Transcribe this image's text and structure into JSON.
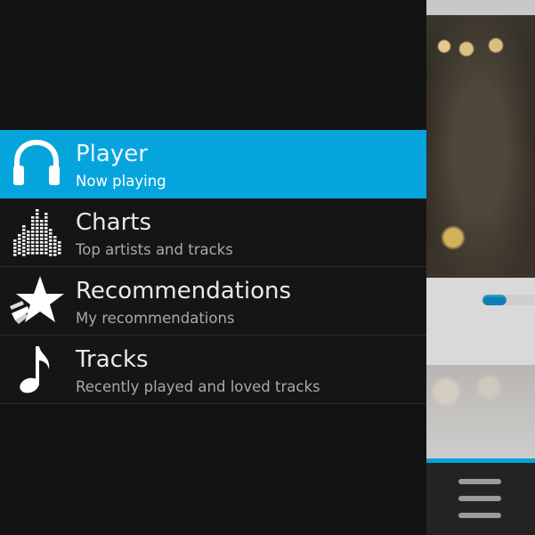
{
  "drawer": {
    "items": [
      {
        "title": "Player",
        "subtitle": "Now playing",
        "icon": "headphones-icon",
        "active": true
      },
      {
        "title": "Charts",
        "subtitle": "Top artists and tracks",
        "icon": "equalizer-bars-icon",
        "active": false
      },
      {
        "title": "Recommendations",
        "subtitle": "My recommendations",
        "icon": "shooting-star-icon",
        "active": false
      },
      {
        "title": "Tracks",
        "subtitle": "Recently played and loved tracks",
        "icon": "music-note-icon",
        "active": false
      }
    ]
  },
  "player_panel": {
    "accent_color": "#07a3d8",
    "slider_level": 0.45,
    "menu_icon": "hamburger-menu-icon"
  },
  "colors": {
    "active_item": "#06a4dd",
    "background": "#121212",
    "slider": "#0a7fb0"
  }
}
